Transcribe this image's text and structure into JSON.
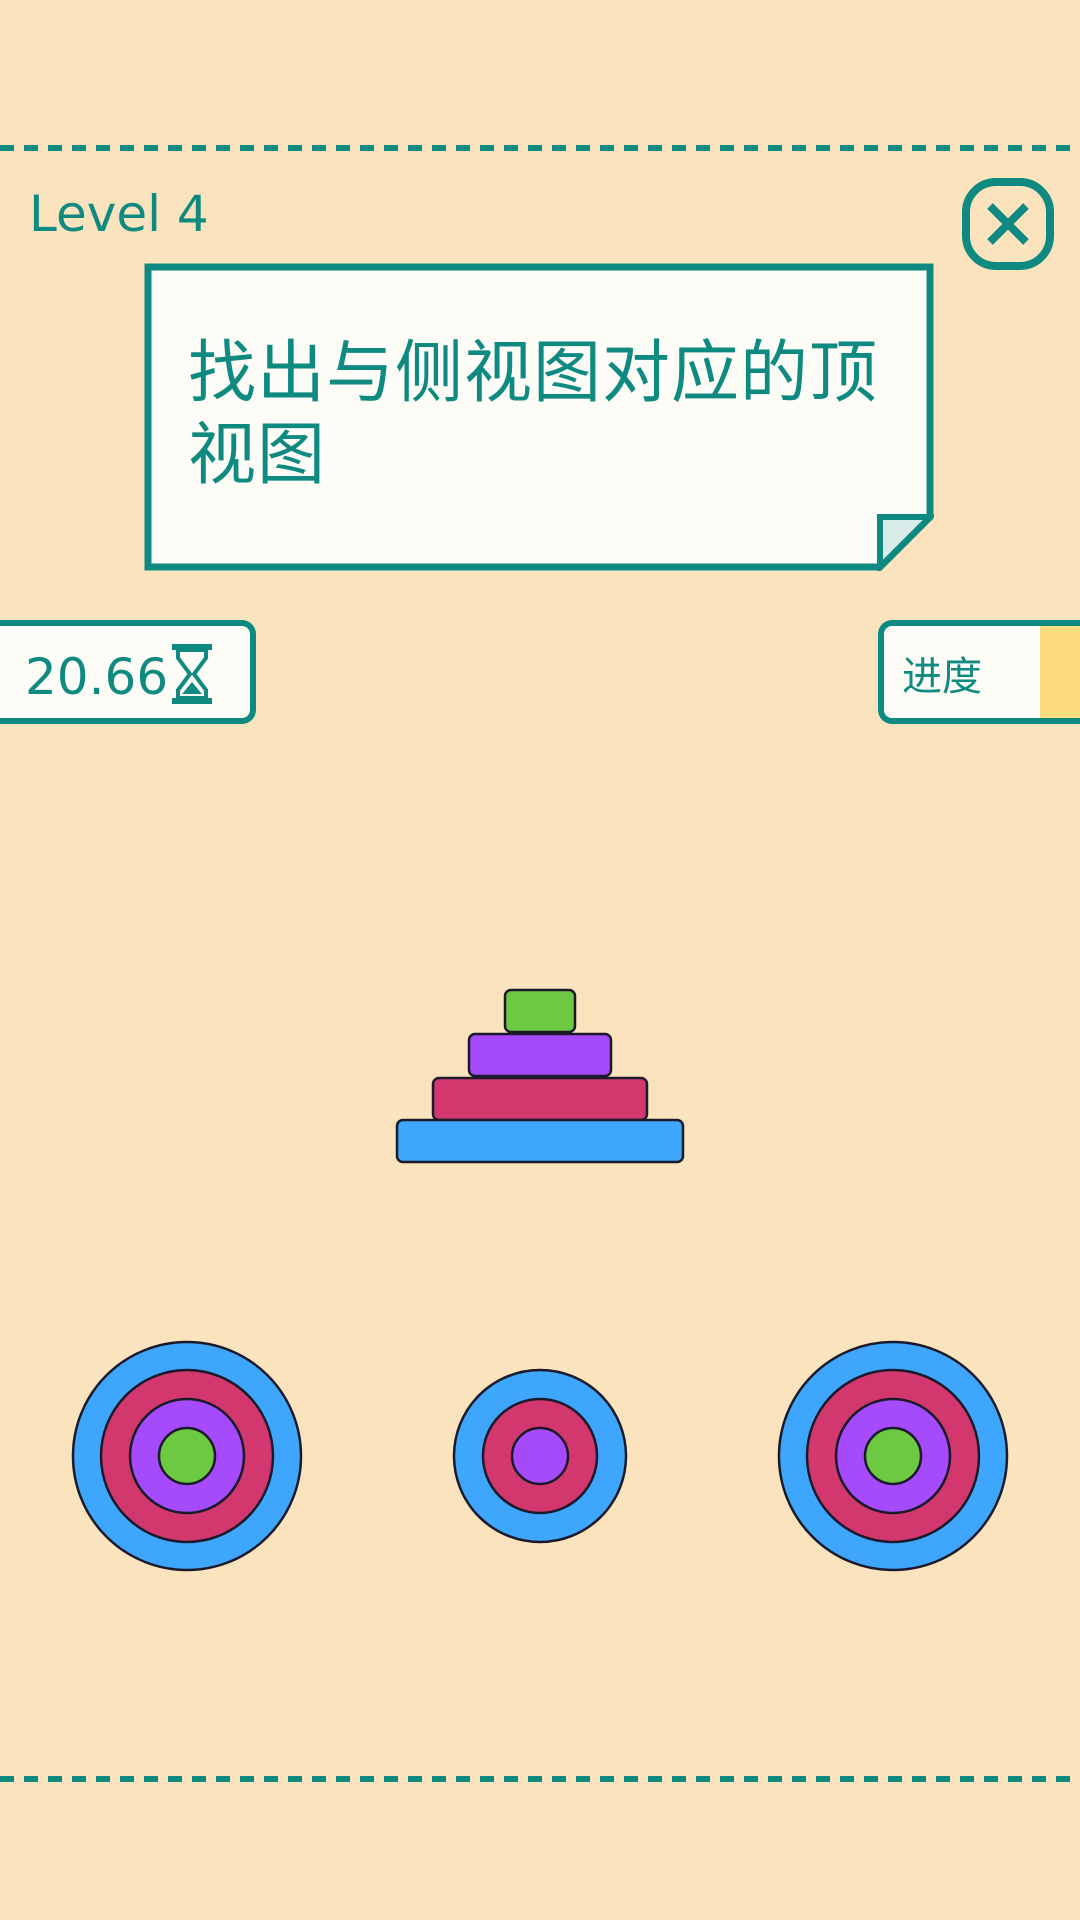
{
  "level": {
    "title": "Level 4"
  },
  "instruction": {
    "text": "找出与侧视图对应的顶视图"
  },
  "timer": {
    "value": "20.66",
    "icon": "hourglass-icon"
  },
  "progress": {
    "label": "进度",
    "fill_color": "#FDDB7E"
  },
  "close": {
    "icon": "close-icon"
  },
  "colors": {
    "background": "#FBE3BE",
    "accent": "#0F8A80",
    "card": "#FDFCF7",
    "blue": "#3EA6FC",
    "magenta": "#D2376E",
    "purple": "#A64BFB",
    "green": "#6DC842",
    "outline": "#1A1A2A"
  },
  "side_view": {
    "layers_top_to_bottom": [
      "green",
      "purple",
      "magenta",
      "blue"
    ]
  },
  "options": [
    {
      "id": "option-1",
      "rings_outer_to_inner": [
        "blue",
        "magenta",
        "purple",
        "green"
      ]
    },
    {
      "id": "option-2",
      "rings_outer_to_inner": [
        "blue",
        "magenta",
        "purple"
      ]
    },
    {
      "id": "option-3",
      "rings_outer_to_inner": [
        "blue",
        "magenta",
        "purple",
        "green"
      ]
    }
  ]
}
